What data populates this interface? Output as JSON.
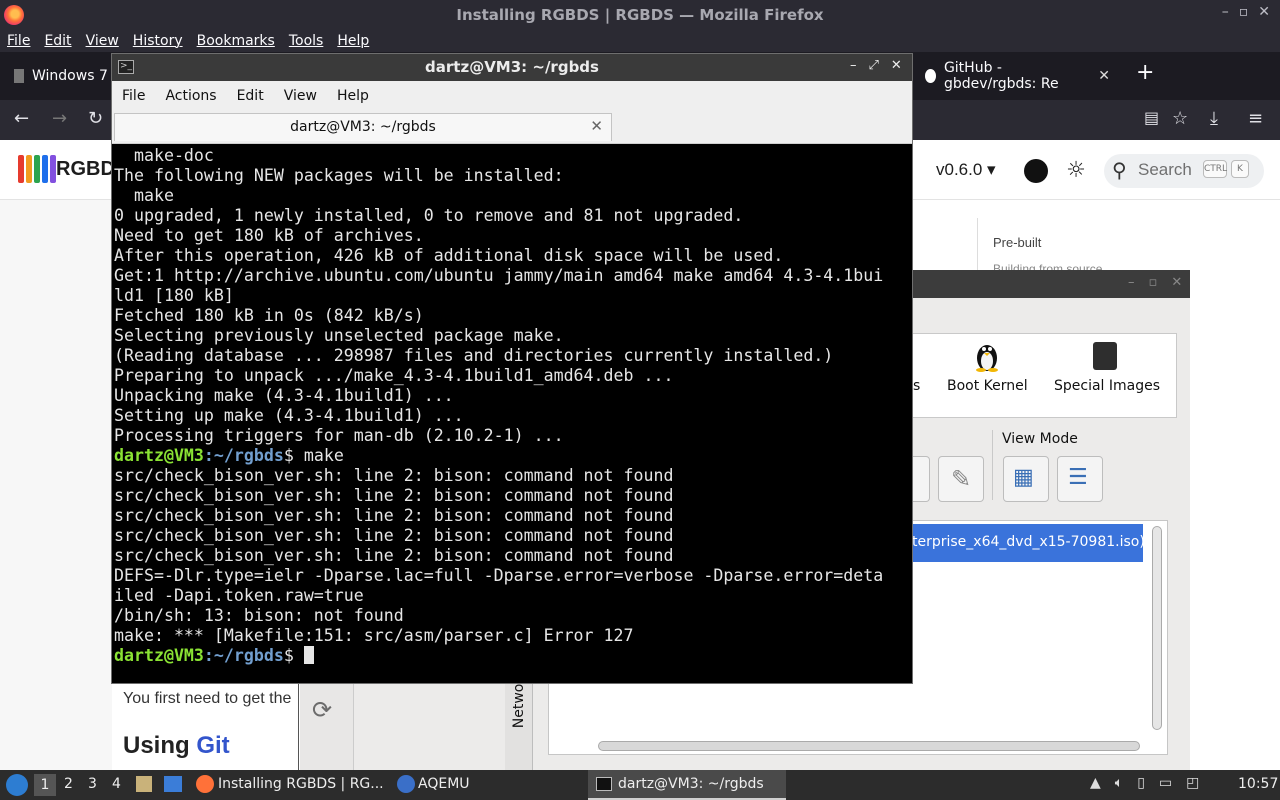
{
  "firefox": {
    "window_title": "Installing RGBDS | RGBDS — Mozilla Firefox",
    "menu": [
      "File",
      "Edit",
      "View",
      "History",
      "Bookmarks",
      "Tools",
      "Help"
    ],
    "tabs": {
      "win7": "Windows 7",
      "github": "GitHub - gbdev/rgbds: Re"
    },
    "new_tab": "+"
  },
  "site": {
    "name": "RGBDS",
    "version": "v0.6.0 ▾",
    "search_label": "Search",
    "kbd_ctrl": "CTRL",
    "kbd_k": "K",
    "toc": {
      "prebuilt": "Pre-built",
      "building": "Building from source"
    },
    "paragraph": "You first need to get the",
    "heading_prefix": "Using ",
    "heading_git": "Git",
    "logo_colors": [
      "#e63b2e",
      "#f29c1f",
      "#2da44e",
      "#1f6feb",
      "#8250df"
    ]
  },
  "terminal": {
    "title": "dartz@VM3: ~/rgbds",
    "tab_title": "dartz@VM3: ~/rgbds",
    "menu": [
      "File",
      "Actions",
      "Edit",
      "View",
      "Help"
    ],
    "lines": [
      "  make-doc",
      "The following NEW packages will be installed:",
      "  make",
      "0 upgraded, 1 newly installed, 0 to remove and 81 not upgraded.",
      "Need to get 180 kB of archives.",
      "After this operation, 426 kB of additional disk space will be used.",
      "Get:1 http://archive.ubuntu.com/ubuntu jammy/main amd64 make amd64 4.3-4.1bui",
      "ld1 [180 kB]",
      "Fetched 180 kB in 0s (842 kB/s)",
      "Selecting previously unselected package make.",
      "(Reading database ... 298987 files and directories currently installed.)",
      "Preparing to unpack .../make_4.3-4.1build1_amd64.deb ...",
      "Unpacking make (4.3-4.1build1) ...",
      "Setting up make (4.3-4.1build1) ...",
      "Processing triggers for man-db (2.10.2-1) ..."
    ],
    "prompt_user": "dartz@VM3",
    "prompt_path": ":~/rgbds",
    "prompt_dollar": "$ ",
    "command": "make",
    "lines2": [
      "src/check_bison_ver.sh: line 2: bison: command not found",
      "src/check_bison_ver.sh: line 2: bison: command not found",
      "src/check_bison_ver.sh: line 2: bison: command not found",
      "src/check_bison_ver.sh: line 2: bison: command not found",
      "src/check_bison_ver.sh: line 2: bison: command not found",
      "DEFS=-Dlr.type=ielr -Dparse.lac=full -Dparse.error=verbose -Dparse.error=deta",
      "iled -Dapi.token.raw=true",
      "/bin/sh: 13: bison: not found",
      "make: *** [Makefile:151: src/asm/parser.c] Error 127"
    ]
  },
  "aqemu": {
    "partial_label": "s",
    "boot_kernel": "Boot Kernel",
    "special_images": "Special Images",
    "view_mode": "View Mode",
    "selected_vm": "terprise_x64_dvd_x15-70981.iso)",
    "network_tab": "Network"
  },
  "taskbar": {
    "workspaces": [
      "1",
      "2",
      "3",
      "4"
    ],
    "items": {
      "firefox": "Installing RGBDS | RG...",
      "aqemu": "AQEMU",
      "terminal": "dartz@VM3: ~/rgbds"
    },
    "clock": "10:57"
  }
}
